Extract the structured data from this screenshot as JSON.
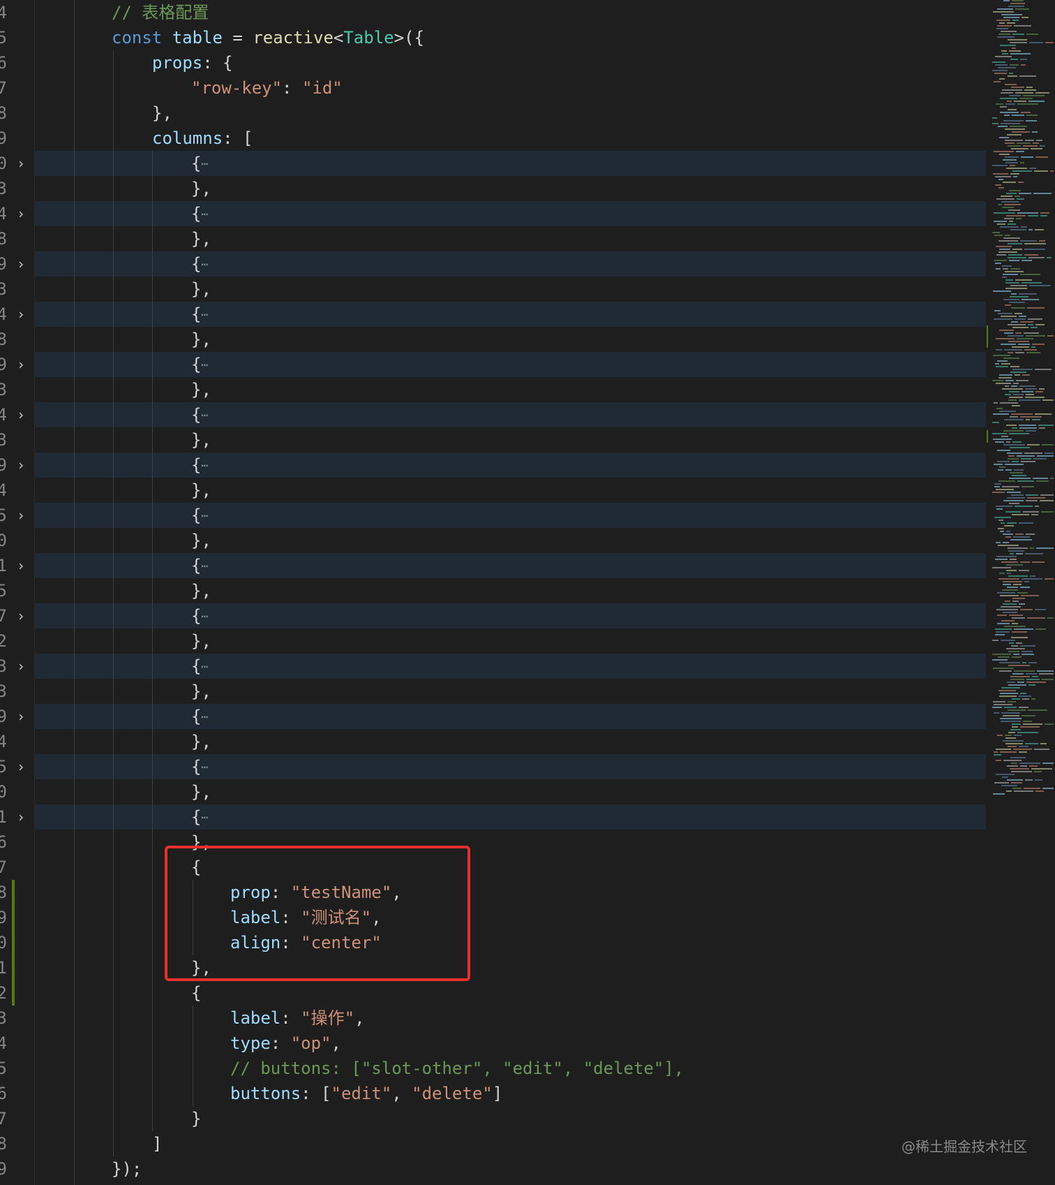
{
  "editor": {
    "lines": [
      {
        "ln": "4",
        "fold": false,
        "folded": false,
        "indent": 160,
        "tokens": [
          {
            "t": "// 表格配置",
            "c": "cmt"
          }
        ]
      },
      {
        "ln": "5",
        "fold": false,
        "folded": false,
        "indent": 160,
        "tokens": [
          {
            "t": "const ",
            "c": "kw"
          },
          {
            "t": "table",
            "c": "var"
          },
          {
            "t": " = ",
            "c": "punc"
          },
          {
            "t": "reactive",
            "c": "fn"
          },
          {
            "t": "<",
            "c": "punc"
          },
          {
            "t": "Table",
            "c": "type"
          },
          {
            "t": ">({",
            "c": "punc"
          }
        ]
      },
      {
        "ln": "6",
        "fold": false,
        "folded": false,
        "indent": 218,
        "tokens": [
          {
            "t": "props",
            "c": "prop"
          },
          {
            "t": ": {",
            "c": "punc"
          }
        ]
      },
      {
        "ln": "7",
        "fold": false,
        "folded": false,
        "indent": 274,
        "tokens": [
          {
            "t": "\"row-key\"",
            "c": "str"
          },
          {
            "t": ": ",
            "c": "punc"
          },
          {
            "t": "\"id\"",
            "c": "str"
          }
        ]
      },
      {
        "ln": "8",
        "fold": false,
        "folded": false,
        "indent": 218,
        "tokens": [
          {
            "t": "},",
            "c": "punc"
          }
        ]
      },
      {
        "ln": "9",
        "fold": false,
        "folded": false,
        "indent": 218,
        "tokens": [
          {
            "t": "columns",
            "c": "prop"
          },
          {
            "t": ": [",
            "c": "punc"
          }
        ]
      },
      {
        "ln": "0",
        "fold": true,
        "folded": true,
        "indent": 274,
        "tokens": [
          {
            "t": "{",
            "c": "punc"
          },
          {
            "t": "⋯",
            "c": "ellipsis"
          }
        ]
      },
      {
        "ln": "3",
        "fold": false,
        "folded": false,
        "indent": 274,
        "tokens": [
          {
            "t": "},",
            "c": "punc"
          }
        ]
      },
      {
        "ln": "4",
        "fold": true,
        "folded": true,
        "indent": 274,
        "tokens": [
          {
            "t": "{",
            "c": "punc"
          },
          {
            "t": "⋯",
            "c": "ellipsis"
          }
        ]
      },
      {
        "ln": "8",
        "fold": false,
        "folded": false,
        "indent": 274,
        "tokens": [
          {
            "t": "},",
            "c": "punc"
          }
        ]
      },
      {
        "ln": "9",
        "fold": true,
        "folded": true,
        "indent": 274,
        "tokens": [
          {
            "t": "{",
            "c": "punc"
          },
          {
            "t": "⋯",
            "c": "ellipsis"
          }
        ]
      },
      {
        "ln": "3",
        "fold": false,
        "folded": false,
        "indent": 274,
        "tokens": [
          {
            "t": "},",
            "c": "punc"
          }
        ]
      },
      {
        "ln": "4",
        "fold": true,
        "folded": true,
        "indent": 274,
        "tokens": [
          {
            "t": "{",
            "c": "punc"
          },
          {
            "t": "⋯",
            "c": "ellipsis"
          }
        ]
      },
      {
        "ln": "8",
        "fold": false,
        "folded": false,
        "indent": 274,
        "tokens": [
          {
            "t": "},",
            "c": "punc"
          }
        ]
      },
      {
        "ln": "9",
        "fold": true,
        "folded": true,
        "indent": 274,
        "tokens": [
          {
            "t": "{",
            "c": "punc"
          },
          {
            "t": "⋯",
            "c": "ellipsis"
          }
        ]
      },
      {
        "ln": "3",
        "fold": false,
        "folded": false,
        "indent": 274,
        "tokens": [
          {
            "t": "},",
            "c": "punc"
          }
        ]
      },
      {
        "ln": "4",
        "fold": true,
        "folded": true,
        "indent": 274,
        "tokens": [
          {
            "t": "{",
            "c": "punc"
          },
          {
            "t": "⋯",
            "c": "ellipsis"
          }
        ]
      },
      {
        "ln": "3",
        "fold": false,
        "folded": false,
        "indent": 274,
        "tokens": [
          {
            "t": "},",
            "c": "punc"
          }
        ]
      },
      {
        "ln": "9",
        "fold": true,
        "folded": true,
        "indent": 274,
        "tokens": [
          {
            "t": "{",
            "c": "punc"
          },
          {
            "t": "⋯",
            "c": "ellipsis"
          }
        ]
      },
      {
        "ln": "4",
        "fold": false,
        "folded": false,
        "indent": 274,
        "tokens": [
          {
            "t": "},",
            "c": "punc"
          }
        ]
      },
      {
        "ln": "5",
        "fold": true,
        "folded": true,
        "indent": 274,
        "tokens": [
          {
            "t": "{",
            "c": "punc"
          },
          {
            "t": "⋯",
            "c": "ellipsis"
          }
        ]
      },
      {
        "ln": "0",
        "fold": false,
        "folded": false,
        "indent": 274,
        "tokens": [
          {
            "t": "},",
            "c": "punc"
          }
        ]
      },
      {
        "ln": "1",
        "fold": true,
        "folded": true,
        "indent": 274,
        "tokens": [
          {
            "t": "{",
            "c": "punc"
          },
          {
            "t": "⋯",
            "c": "ellipsis"
          }
        ]
      },
      {
        "ln": "5",
        "fold": false,
        "folded": false,
        "indent": 274,
        "tokens": [
          {
            "t": "},",
            "c": "punc"
          }
        ]
      },
      {
        "ln": "7",
        "fold": true,
        "folded": true,
        "indent": 274,
        "tokens": [
          {
            "t": "{",
            "c": "punc"
          },
          {
            "t": "⋯",
            "c": "ellipsis"
          }
        ]
      },
      {
        "ln": "2",
        "fold": false,
        "folded": false,
        "indent": 274,
        "tokens": [
          {
            "t": "},",
            "c": "punc"
          }
        ]
      },
      {
        "ln": "3",
        "fold": true,
        "folded": true,
        "indent": 274,
        "tokens": [
          {
            "t": "{",
            "c": "punc"
          },
          {
            "t": "⋯",
            "c": "ellipsis"
          }
        ]
      },
      {
        "ln": "3",
        "fold": false,
        "folded": false,
        "indent": 274,
        "tokens": [
          {
            "t": "},",
            "c": "punc"
          }
        ]
      },
      {
        "ln": "9",
        "fold": true,
        "folded": true,
        "indent": 274,
        "tokens": [
          {
            "t": "{",
            "c": "punc"
          },
          {
            "t": "⋯",
            "c": "ellipsis"
          }
        ]
      },
      {
        "ln": "4",
        "fold": false,
        "folded": false,
        "indent": 274,
        "tokens": [
          {
            "t": "},",
            "c": "punc"
          }
        ]
      },
      {
        "ln": "5",
        "fold": true,
        "folded": true,
        "indent": 274,
        "tokens": [
          {
            "t": "{",
            "c": "punc"
          },
          {
            "t": "⋯",
            "c": "ellipsis"
          }
        ]
      },
      {
        "ln": "0",
        "fold": false,
        "folded": false,
        "indent": 274,
        "tokens": [
          {
            "t": "},",
            "c": "punc"
          }
        ]
      },
      {
        "ln": "1",
        "fold": true,
        "folded": true,
        "indent": 274,
        "tokens": [
          {
            "t": "{",
            "c": "punc"
          },
          {
            "t": "⋯",
            "c": "ellipsis"
          }
        ]
      },
      {
        "ln": "6",
        "fold": false,
        "folded": false,
        "indent": 274,
        "tokens": [
          {
            "t": "},",
            "c": "punc"
          }
        ]
      },
      {
        "ln": "7",
        "fold": false,
        "folded": false,
        "indent": 274,
        "tokens": [
          {
            "t": "{",
            "c": "punc"
          }
        ]
      },
      {
        "ln": "8",
        "fold": false,
        "folded": false,
        "indent": 330,
        "tokens": [
          {
            "t": "prop",
            "c": "prop"
          },
          {
            "t": ": ",
            "c": "punc"
          },
          {
            "t": "\"testName\"",
            "c": "str"
          },
          {
            "t": ",",
            "c": "punc"
          }
        ]
      },
      {
        "ln": "9",
        "fold": false,
        "folded": false,
        "indent": 330,
        "tokens": [
          {
            "t": "label",
            "c": "prop"
          },
          {
            "t": ": ",
            "c": "punc"
          },
          {
            "t": "\"测试名\"",
            "c": "str"
          },
          {
            "t": ",",
            "c": "punc"
          }
        ]
      },
      {
        "ln": "0",
        "fold": false,
        "folded": false,
        "indent": 330,
        "tokens": [
          {
            "t": "align",
            "c": "prop"
          },
          {
            "t": ": ",
            "c": "punc"
          },
          {
            "t": "\"center\"",
            "c": "str"
          }
        ]
      },
      {
        "ln": "1",
        "fold": false,
        "folded": false,
        "indent": 274,
        "tokens": [
          {
            "t": "},",
            "c": "punc"
          }
        ]
      },
      {
        "ln": "2",
        "fold": false,
        "folded": false,
        "indent": 274,
        "tokens": [
          {
            "t": "{",
            "c": "punc"
          }
        ]
      },
      {
        "ln": "3",
        "fold": false,
        "folded": false,
        "indent": 330,
        "tokens": [
          {
            "t": "label",
            "c": "prop"
          },
          {
            "t": ": ",
            "c": "punc"
          },
          {
            "t": "\"操作\"",
            "c": "str"
          },
          {
            "t": ",",
            "c": "punc"
          }
        ]
      },
      {
        "ln": "4",
        "fold": false,
        "folded": false,
        "indent": 330,
        "tokens": [
          {
            "t": "type",
            "c": "prop"
          },
          {
            "t": ": ",
            "c": "punc"
          },
          {
            "t": "\"op\"",
            "c": "str"
          },
          {
            "t": ",",
            "c": "punc"
          }
        ]
      },
      {
        "ln": "5",
        "fold": false,
        "folded": false,
        "indent": 330,
        "tokens": [
          {
            "t": "// buttons: [\"slot-other\", \"edit\", \"delete\"],",
            "c": "cmt"
          }
        ]
      },
      {
        "ln": "6",
        "fold": false,
        "folded": false,
        "indent": 330,
        "tokens": [
          {
            "t": "buttons",
            "c": "prop"
          },
          {
            "t": ": [",
            "c": "punc"
          },
          {
            "t": "\"edit\"",
            "c": "str"
          },
          {
            "t": ", ",
            "c": "punc"
          },
          {
            "t": "\"delete\"",
            "c": "str"
          },
          {
            "t": "]",
            "c": "punc"
          }
        ]
      },
      {
        "ln": "7",
        "fold": false,
        "folded": false,
        "indent": 274,
        "tokens": [
          {
            "t": "}",
            "c": "punc"
          }
        ]
      },
      {
        "ln": "8",
        "fold": false,
        "folded": false,
        "indent": 218,
        "tokens": [
          {
            "t": "]",
            "c": "punc"
          }
        ]
      },
      {
        "ln": "9",
        "fold": false,
        "folded": false,
        "indent": 160,
        "tokens": [
          {
            "t": "});",
            "c": "punc"
          }
        ]
      }
    ]
  },
  "watermark": {
    "text": "@稀土掘金技术社区"
  },
  "colors": {
    "background": "#1e1e1e",
    "folded_line_bg": "#1f2a35",
    "keyword": "#569cd6",
    "property": "#9cdcfe",
    "string": "#ce9178",
    "function": "#dcdcaa",
    "type": "#4ec9b0",
    "comment": "#6a9955",
    "highlight_box": "#e8312a",
    "git_added": "#587c0c"
  }
}
